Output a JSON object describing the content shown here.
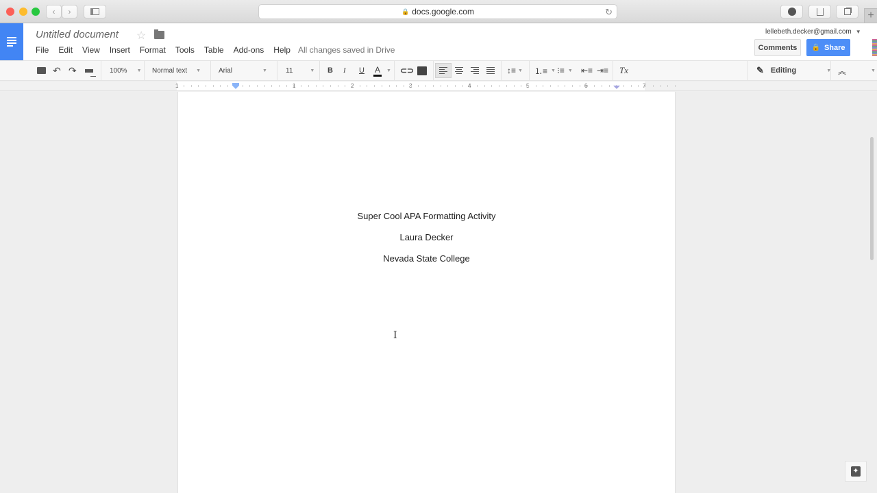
{
  "browser": {
    "url": "docs.google.com",
    "lock_icon": "🔒",
    "reload_icon": "↻",
    "back_icon": "‹",
    "forward_icon": "›",
    "new_tab_icon": "+"
  },
  "header": {
    "title": "Untitled document",
    "star_icon": "☆",
    "menu": [
      "File",
      "Edit",
      "View",
      "Insert",
      "Format",
      "Tools",
      "Table",
      "Add-ons",
      "Help"
    ],
    "save_status": "All changes saved in Drive",
    "account": "lellebeth.decker@gmail.com",
    "comments_label": "Comments",
    "share_label": "Share"
  },
  "toolbar": {
    "zoom": "100%",
    "style": "Normal text",
    "font": "Arial",
    "size": "11",
    "bold": "B",
    "italic": "I",
    "underline": "U",
    "text_color": "A",
    "clear_format": "Tx",
    "mode": "Editing",
    "collapse_icon": "︽"
  },
  "ruler": {
    "labels": [
      "1",
      "1",
      "2",
      "3",
      "4",
      "5",
      "6",
      "7"
    ]
  },
  "document": {
    "lines": [
      "Super Cool APA Formatting Activity",
      "Laura Decker",
      "Nevada State College"
    ]
  },
  "colors": {
    "docs_blue": "#4285f4",
    "share_blue": "#4d8ef7"
  }
}
